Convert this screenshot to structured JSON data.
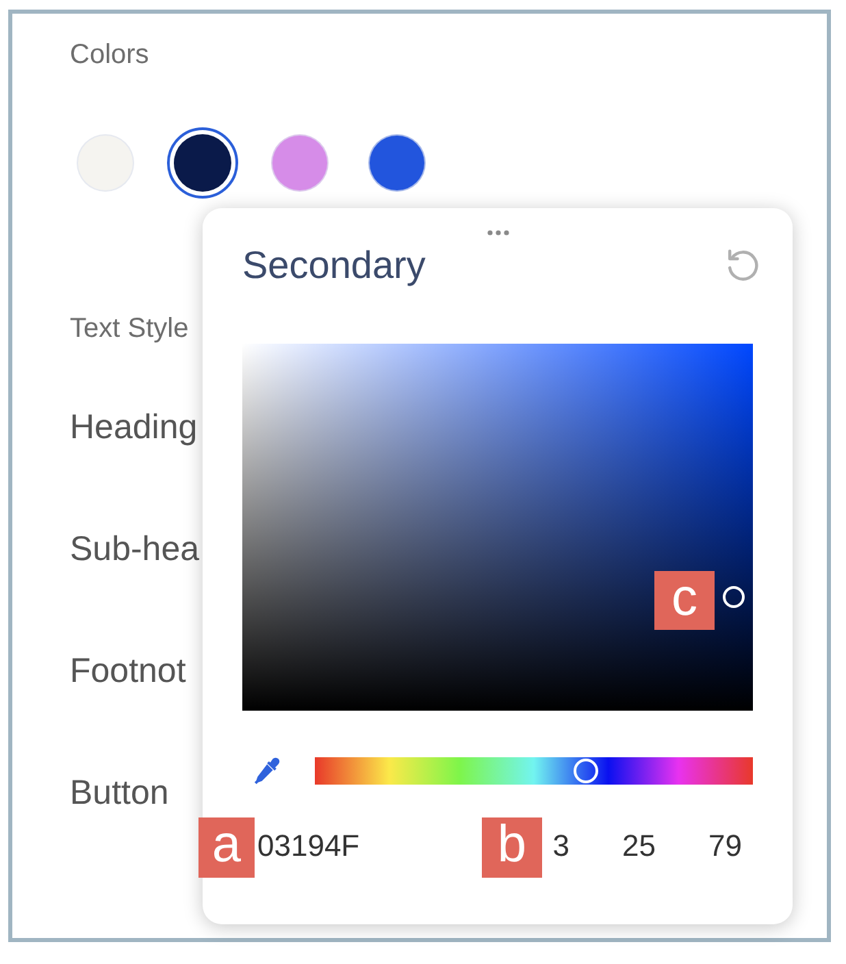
{
  "panel": {
    "colors_label": "Colors",
    "swatches": [
      {
        "color": "#f5f4f0",
        "selected": false
      },
      {
        "color": "#0a1a4a",
        "selected": true
      },
      {
        "color": "#d68ce8",
        "selected": false
      },
      {
        "color": "#2255dd",
        "selected": false
      }
    ],
    "text_styles_label": "Text Style",
    "text_styles": [
      "Heading",
      "Sub-hea",
      "Footnot",
      "Button"
    ]
  },
  "color_picker": {
    "title": "Secondary",
    "hue_slider": {
      "level": 0.62
    },
    "hex": "03194F",
    "rgb": [
      "3",
      "25",
      "79"
    ]
  },
  "annotations": [
    {
      "label": "a"
    },
    {
      "label": "b"
    },
    {
      "label": "c"
    }
  ]
}
